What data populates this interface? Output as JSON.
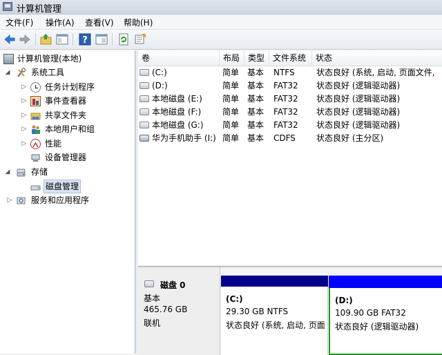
{
  "window": {
    "title": "计算机管理"
  },
  "menu": [
    "文件(F)",
    "操作(A)",
    "查看(V)",
    "帮助(H)"
  ],
  "toolbar": [
    "back-icon",
    "forward-icon",
    "up-folder-icon",
    "show-hide-tree-icon",
    "help-icon",
    "properties-icon",
    "refresh-icon",
    "export-icon"
  ],
  "tree": {
    "root": "计算机管理(本地)",
    "system_tools": "系统工具",
    "task_scheduler": "任务计划程序",
    "event_viewer": "事件查看器",
    "shared_folders": "共享文件夹",
    "local_users": "本地用户和组",
    "performance": "性能",
    "device_manager": "设备管理器",
    "storage": "存储",
    "disk_management": "磁盘管理",
    "services_apps": "服务和应用程序"
  },
  "volumes": {
    "columns": [
      "卷",
      "布局",
      "类型",
      "文件系统",
      "状态"
    ],
    "rows": [
      [
        "(C:)",
        "简单",
        "基本",
        "NTFS",
        "状态良好 (系统, 启动, 页面文件,"
      ],
      [
        "(D:)",
        "简单",
        "基本",
        "FAT32",
        "状态良好 (逻辑驱动器)"
      ],
      [
        "本地磁盘 (E:)",
        "简单",
        "基本",
        "FAT32",
        "状态良好 (逻辑驱动器)"
      ],
      [
        "本地磁盘 (F:)",
        "简单",
        "基本",
        "FAT32",
        "状态良好 (逻辑驱动器)"
      ],
      [
        "本地磁盘 (G:)",
        "简单",
        "基本",
        "FAT32",
        "状态良好 (逻辑驱动器)"
      ],
      [
        "华为手机助手 (I:)",
        "简单",
        "基本",
        "CDFS",
        "状态良好 (主分区)"
      ]
    ]
  },
  "disk0": {
    "name": "磁盘 0",
    "type": "基本",
    "size": "465.76 GB",
    "status": "联机",
    "partitions": [
      {
        "name": "(C:)",
        "info": "29.30 GB NTFS",
        "status": "状态良好 (系统, 启动, 页面",
        "color": "#00008b"
      },
      {
        "name": "(D:)",
        "info": "109.90 GB FAT32",
        "status": "状态良好 (逻辑驱动器)",
        "color": "#0000ff"
      }
    ]
  },
  "colors": {
    "primary_partition": "#00008b",
    "logical_drive": "#0000ff",
    "extended_border": "#1a9a1a"
  }
}
